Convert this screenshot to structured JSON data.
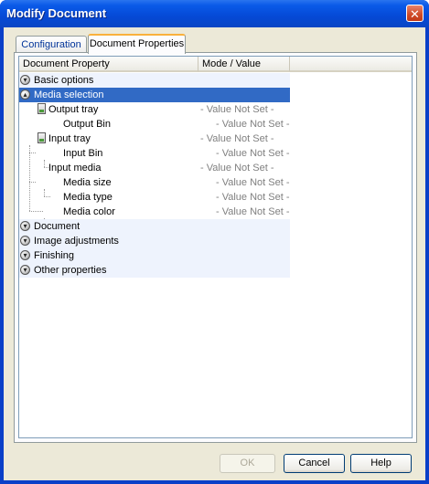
{
  "window": {
    "title": "Modify Document",
    "close_glyph": "✕"
  },
  "tabs": [
    {
      "label": "Configuration"
    },
    {
      "label": "Document Properties"
    }
  ],
  "tree": {
    "headers": {
      "property": "Document Property",
      "value": "Mode / Value"
    },
    "rows": [
      {
        "label": "Basic options"
      },
      {
        "label": "Media selection"
      },
      {
        "label": "Output tray",
        "value": "- Value Not Set -"
      },
      {
        "label": "Output Bin",
        "value": "- Value Not Set -"
      },
      {
        "label": "Input tray",
        "value": "- Value Not Set -"
      },
      {
        "label": "Input Bin",
        "value": "- Value Not Set -"
      },
      {
        "label": "Input media",
        "value": "- Value Not Set -"
      },
      {
        "label": "Media size",
        "value": "- Value Not Set -"
      },
      {
        "label": "Media type",
        "value": "- Value Not Set -"
      },
      {
        "label": "Media color",
        "value": "- Value Not Set -"
      },
      {
        "label": "Document"
      },
      {
        "label": "Image adjustments"
      },
      {
        "label": "Finishing"
      },
      {
        "label": "Other properties"
      }
    ]
  },
  "buttons": {
    "ok": "OK",
    "cancel": "Cancel",
    "help": "Help"
  },
  "icons": {
    "expand": "expand-circle-icon",
    "collapse": "collapse-circle-icon",
    "tray": "paper-tray-icon"
  },
  "colors": {
    "title_bar": "#0549d6",
    "selection": "#316ac5",
    "row_tint": "#eef3fd",
    "value_text": "#808080"
  }
}
